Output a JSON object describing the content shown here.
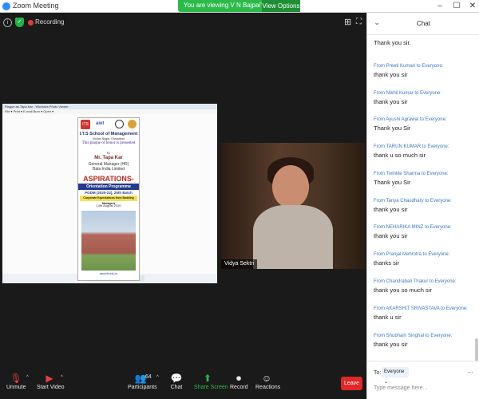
{
  "window": {
    "title": "Zoom Meeting",
    "minimize": "–",
    "maximize": "☐",
    "close": "✕"
  },
  "share_banner": {
    "text": "You are viewing V N Bajpai's screen",
    "view_options": "View Options ⌄"
  },
  "status": {
    "info": "i",
    "shield": "✓",
    "recording": "Recording",
    "grid": "⊞",
    "fullscreen": "⛶"
  },
  "shared_screen": {
    "app_title": "Plaque.ak.Tapa Kar - Windows Photo Viewer",
    "menu": "File ▾   Print ▾   E-mail   Burn ▾   Open ▾",
    "controls": "⊕ ▾  |◀  ▣  ▶|  ↺ ↻  ✕",
    "plaque": {
      "logo_a": "ITS",
      "logo_b": "aiet",
      "school": "I.T.S School of Management",
      "place": "Mohan Nagar, Ghaziabad",
      "presented": "This plaque of honor is presented",
      "to": "to",
      "name": "Mr. Tapa Kar",
      "designation_1": "General Manager (HR)",
      "designation_2": "Bata India Limited",
      "event": "ASPIRATIONS-2020",
      "programme": "Orientation Programme",
      "batch": "PGDM (2020-22), 25th Batch",
      "tagline": "Corporate Expectations from Budding Managers",
      "date": "14th August 2020",
      "website": "www.its.edu.in"
    }
  },
  "video": {
    "participant_name": "Vidya Sektri"
  },
  "toolbar": {
    "unmute": "Unmute",
    "start_video": "Start Video",
    "participants": "Participants",
    "participants_count": "64",
    "chat": "Chat",
    "share_screen": "Share Screen",
    "record": "Record",
    "reactions": "Reactions",
    "leave": "Leave",
    "caret": "^"
  },
  "chat": {
    "title": "Chat",
    "collapse": "⌄",
    "messages": [
      {
        "from": "",
        "text": "Thank you sir."
      },
      {
        "from": "From Preeti Kumari to Everyone:",
        "text": "thank you sir"
      },
      {
        "from": "From Nikhil Kumar to Everyone:",
        "text": "thank you sir"
      },
      {
        "from": "From Ayushi Agrawal to Everyone:",
        "text": "Thank you Sir"
      },
      {
        "from": "From TARUN KUMAR to Everyone:",
        "text": "thank u so much sir"
      },
      {
        "from": "From Twinkle Sharma to Everyone:",
        "text": "Thank you Sir"
      },
      {
        "from": "From Tanya Chaudhary to Everyone:",
        "text": "thank you sir"
      },
      {
        "from": "From NEHARIKA MINZ to Everyone:",
        "text": "thank you sir"
      },
      {
        "from": "From Pranjal Mehrotra to Everyone:",
        "text": "thanks sir"
      },
      {
        "from": "From Chandrabali Thakur to Everyone:",
        "text": "thank you so much sir"
      },
      {
        "from": "From AKARSHIT SRIVASTAVA to Everyone:",
        "text": "thank u sir"
      },
      {
        "from": "From Shubham Singhal to Everyone:",
        "text": "thank you sir"
      }
    ],
    "to_label": "To:",
    "recipient": "Everyone ⌄",
    "file_icon": "⋯",
    "placeholder": "Type message here..."
  }
}
